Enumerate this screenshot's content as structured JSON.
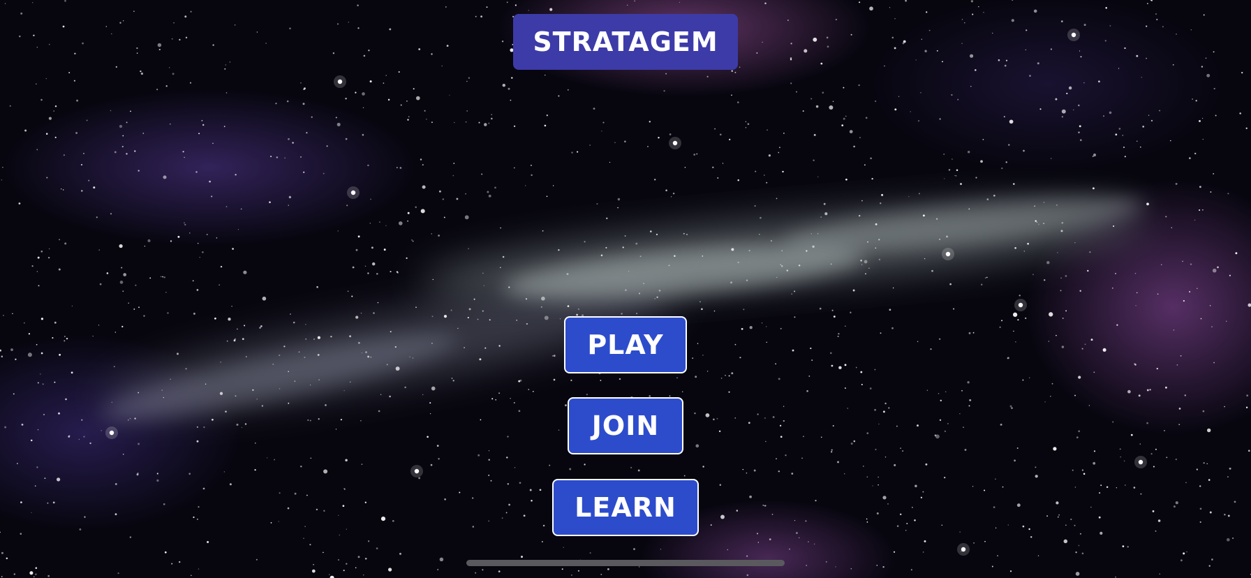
{
  "title": "STRATAGEM",
  "menu": {
    "play_label": "PLAY",
    "join_label": "JOIN",
    "learn_label": "LEARN"
  },
  "colors": {
    "title_banner": "#3d3ba8",
    "button_fill": "#2d4ccc",
    "button_border": "#ffffff",
    "text": "#ffffff"
  },
  "background": "starfield-galaxy"
}
